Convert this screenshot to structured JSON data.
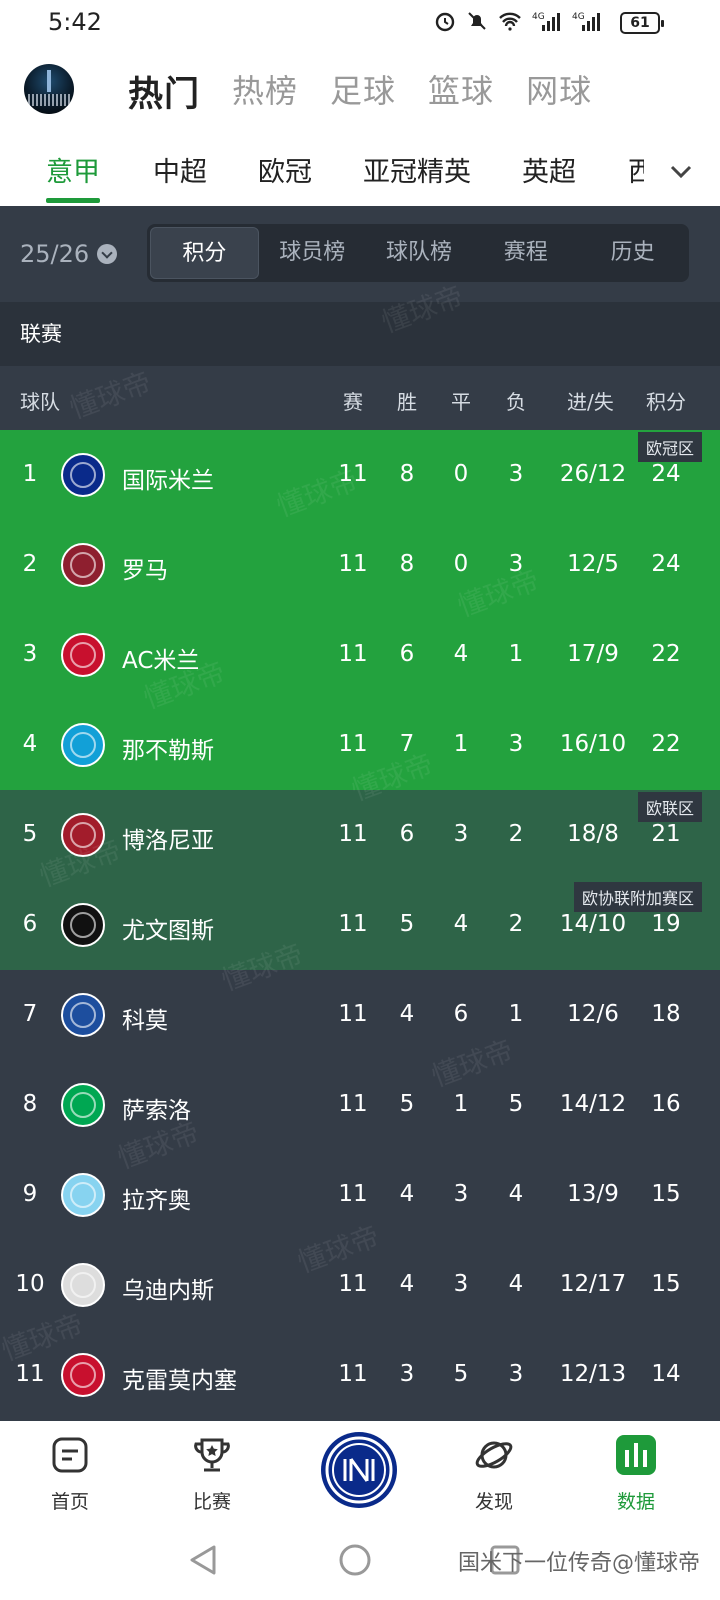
{
  "status_bar": {
    "time": "5:42",
    "battery": "61",
    "icons": [
      "alarm-icon",
      "mute-icon",
      "wifi-icon",
      "signal-4g-icon",
      "signal-4g-icon"
    ]
  },
  "top_nav": {
    "tabs": [
      {
        "label": "热门",
        "active": true
      },
      {
        "label": "热榜",
        "active": false
      },
      {
        "label": "足球",
        "active": false
      },
      {
        "label": "篮球",
        "active": false
      },
      {
        "label": "网球",
        "active": false
      }
    ]
  },
  "league_tabs": [
    {
      "label": "意甲",
      "active": true
    },
    {
      "label": "中超",
      "active": false
    },
    {
      "label": "欧冠",
      "active": false
    },
    {
      "label": "亚冠精英",
      "active": false
    },
    {
      "label": "英超",
      "active": false
    },
    {
      "label": "西",
      "active": false
    }
  ],
  "season": "25/26",
  "segments": [
    {
      "label": "积分",
      "active": true
    },
    {
      "label": "球员榜",
      "active": false
    },
    {
      "label": "球队榜",
      "active": false
    },
    {
      "label": "赛程",
      "active": false
    },
    {
      "label": "历史",
      "active": false
    }
  ],
  "league_label": "联赛",
  "table": {
    "headers": {
      "team": "球队",
      "played": "赛",
      "won": "胜",
      "drawn": "平",
      "lost": "负",
      "goals": "进/失",
      "points": "积分"
    },
    "rows": [
      {
        "rank": "1",
        "team": "国际米兰",
        "played": "11",
        "won": "8",
        "drawn": "0",
        "lost": "3",
        "goals": "26/12",
        "points": "24",
        "zone": "ucl",
        "zone_label": "欧冠区",
        "logo_color": "#0a2a8a"
      },
      {
        "rank": "2",
        "team": "罗马",
        "played": "11",
        "won": "8",
        "drawn": "0",
        "lost": "3",
        "goals": "12/5",
        "points": "24",
        "zone": "ucl",
        "zone_label": "",
        "logo_color": "#8e1f2f"
      },
      {
        "rank": "3",
        "team": "AC米兰",
        "played": "11",
        "won": "6",
        "drawn": "4",
        "lost": "1",
        "goals": "17/9",
        "points": "22",
        "zone": "ucl",
        "zone_label": "",
        "logo_color": "#c8102e"
      },
      {
        "rank": "4",
        "team": "那不勒斯",
        "played": "11",
        "won": "7",
        "drawn": "1",
        "lost": "3",
        "goals": "16/10",
        "points": "22",
        "zone": "ucl",
        "zone_label": "",
        "logo_color": "#12a0d7"
      },
      {
        "rank": "5",
        "team": "博洛尼亚",
        "played": "11",
        "won": "6",
        "drawn": "3",
        "lost": "2",
        "goals": "18/8",
        "points": "21",
        "zone": "uel",
        "zone_label": "欧联区",
        "logo_color": "#a21c2b"
      },
      {
        "rank": "6",
        "team": "尤文图斯",
        "played": "11",
        "won": "5",
        "drawn": "4",
        "lost": "2",
        "goals": "14/10",
        "points": "19",
        "zone": "conf",
        "zone_label": "欧协联附加赛区",
        "logo_color": "#111111"
      },
      {
        "rank": "7",
        "team": "科莫",
        "played": "11",
        "won": "4",
        "drawn": "6",
        "lost": "1",
        "goals": "12/6",
        "points": "18",
        "zone": "none",
        "zone_label": "",
        "logo_color": "#1d4e9e"
      },
      {
        "rank": "8",
        "team": "萨索洛",
        "played": "11",
        "won": "5",
        "drawn": "1",
        "lost": "5",
        "goals": "14/12",
        "points": "16",
        "zone": "none",
        "zone_label": "",
        "logo_color": "#00a752"
      },
      {
        "rank": "9",
        "team": "拉齐奥",
        "played": "11",
        "won": "4",
        "drawn": "3",
        "lost": "4",
        "goals": "13/9",
        "points": "15",
        "zone": "none",
        "zone_label": "",
        "logo_color": "#87d3f0"
      },
      {
        "rank": "10",
        "team": "乌迪内斯",
        "played": "11",
        "won": "4",
        "drawn": "3",
        "lost": "4",
        "goals": "12/17",
        "points": "15",
        "zone": "none",
        "zone_label": "",
        "logo_color": "#dddddd"
      },
      {
        "rank": "11",
        "team": "克雷莫内塞",
        "played": "11",
        "won": "3",
        "drawn": "5",
        "lost": "3",
        "goals": "12/13",
        "points": "14",
        "zone": "none",
        "zone_label": "",
        "logo_color": "#c8102e"
      }
    ]
  },
  "bottom_nav": {
    "items": [
      {
        "label": "首页",
        "icon": "home-icon",
        "active": false
      },
      {
        "label": "比赛",
        "icon": "trophy-icon",
        "active": false
      },
      {
        "label": "",
        "icon": "inter-logo-icon",
        "active": false
      },
      {
        "label": "发现",
        "icon": "planet-icon",
        "active": false
      },
      {
        "label": "数据",
        "icon": "data-bars-icon",
        "active": true
      }
    ]
  },
  "system_nav": {
    "credit": "国米下一位传奇@懂球帝"
  },
  "colors": {
    "accent_green": "#1e9a3a",
    "ucl_zone": "#23a23e",
    "uel_zone": "#2e6448",
    "dark_bg": "#343c47"
  },
  "watermark": "懂球帝"
}
